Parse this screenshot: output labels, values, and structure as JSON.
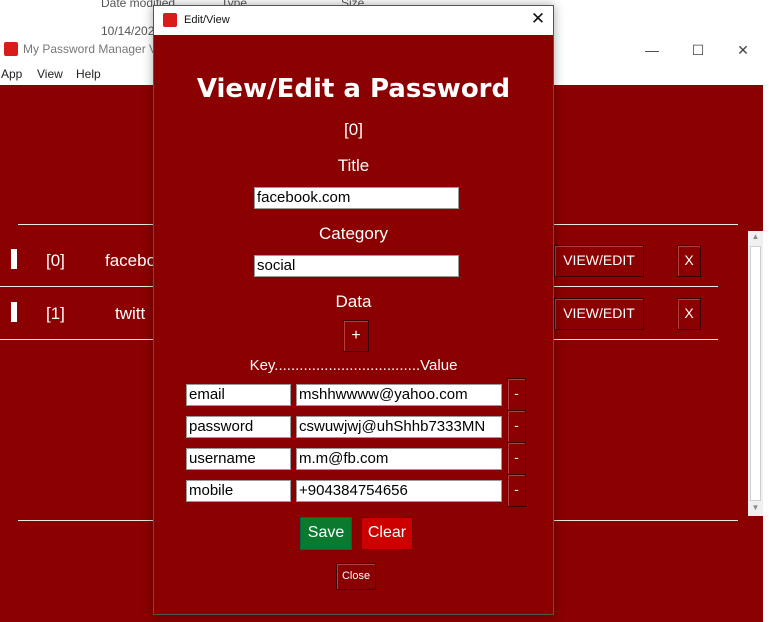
{
  "explorer": {
    "date_modified": "Date modified",
    "type": "Type",
    "size": "Size",
    "date_value": "10/14/202"
  },
  "main_window": {
    "title": "My Password Manager V",
    "menu": [
      "App",
      "View",
      "Help"
    ],
    "rows": [
      {
        "index": "[0]",
        "title": "facebo",
        "view_edit": "VIEW/EDIT",
        "delete": "X"
      },
      {
        "index": "[1]",
        "title": "twitt",
        "view_edit": "VIEW/EDIT",
        "delete": "X"
      }
    ]
  },
  "dialog": {
    "window_title": "Edit/View",
    "heading": "View/Edit a Password",
    "index": "[0]",
    "title_label": "Title",
    "title_value": "facebook.com",
    "category_label": "Category",
    "category_value": "social",
    "data_label": "Data",
    "add_button": "+",
    "kv_header": "Key...................................Value",
    "entries": [
      {
        "key": "email",
        "value": "mshhwwww@yahoo.com",
        "remove": "-"
      },
      {
        "key": "password",
        "value": "cswuwjwj@uhShhb7333MN",
        "remove": "-"
      },
      {
        "key": "username",
        "value": "m.m@fb.com",
        "remove": "-"
      },
      {
        "key": "mobile",
        "value": "+904384754656",
        "remove": "-"
      }
    ],
    "save_button": "Save",
    "clear_button": "Clear",
    "close_button": "Close"
  },
  "colors": {
    "background": "#8b0000",
    "save": "#0a7a2e",
    "clear": "#cc0000",
    "icon": "#d81b1b"
  }
}
